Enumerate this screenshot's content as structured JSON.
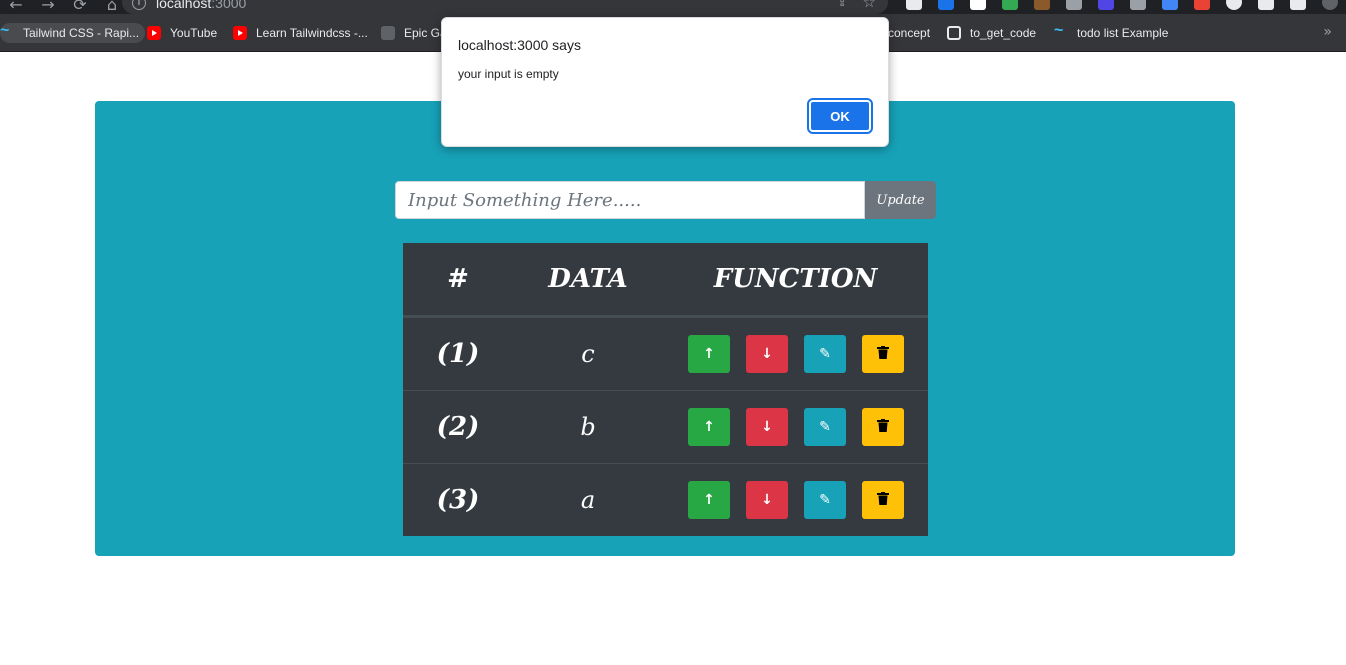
{
  "browser": {
    "nav": {
      "back": "←",
      "forward": "→",
      "reload": "⟳",
      "home": "⌂"
    },
    "address": {
      "host": "localhost",
      "port": ":3000"
    },
    "bookmarks": [
      {
        "label": "Tailwind CSS - Rapi...",
        "icon": "tailwind-icon"
      },
      {
        "label": "YouTube",
        "icon": "youtube-icon"
      },
      {
        "label": "Learn Tailwindcss -...",
        "icon": "youtube-icon"
      },
      {
        "label": "Epic Ga",
        "icon": "epic-games-icon"
      },
      {
        "label": "concept",
        "icon": "bookmark-icon"
      },
      {
        "label": "to_get_code",
        "icon": "codepen-icon"
      },
      {
        "label": "todo list Example",
        "icon": "tailwind-icon"
      }
    ],
    "more": "»"
  },
  "dialog": {
    "title": "localhost:3000 says",
    "message": "your input is empty",
    "ok_label": "OK"
  },
  "app": {
    "input_placeholder": "Input Something Here.....",
    "input_value": "",
    "update_label": "Update",
    "headers": {
      "num": "#",
      "data": "DATA",
      "function": "FUNCTION"
    },
    "rows": [
      {
        "num": "(1)",
        "data": "c"
      },
      {
        "num": "(2)",
        "data": "b"
      },
      {
        "num": "(3)",
        "data": "a"
      }
    ],
    "action_icons": {
      "up": "↑",
      "down": "↓",
      "edit": "✎",
      "delete": "🗑"
    },
    "colors": {
      "panel": "#17a2b8",
      "table": "#343a40",
      "up": "#28a745",
      "down": "#dc3545",
      "edit": "#17a2b8",
      "delete": "#ffc107"
    }
  }
}
